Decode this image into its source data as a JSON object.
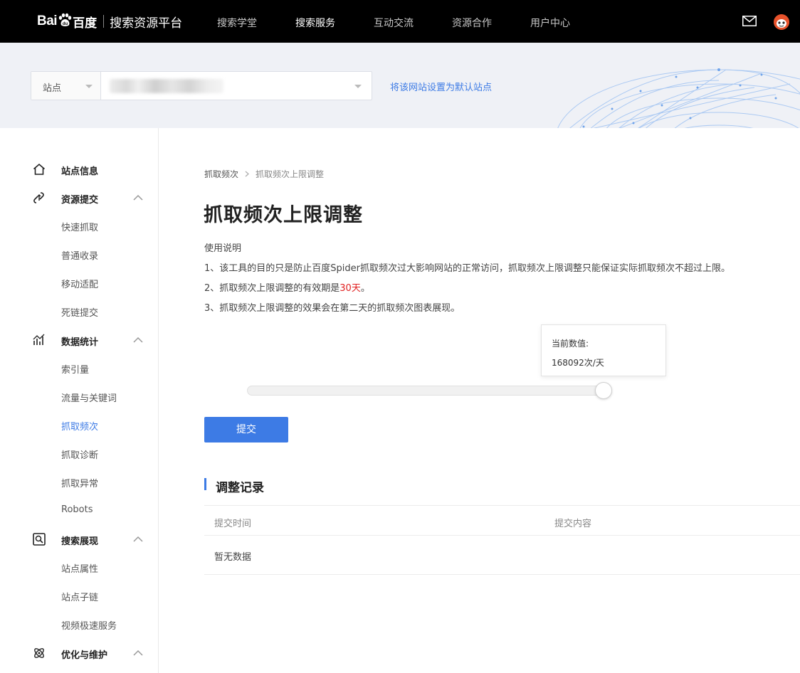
{
  "header": {
    "logo_bai": "Bai",
    "logo_du": "百度",
    "platform_title": "搜索资源平台",
    "nav": [
      {
        "label": "搜索学堂",
        "active": false
      },
      {
        "label": "搜索服务",
        "active": true
      },
      {
        "label": "互动交流",
        "active": false
      },
      {
        "label": "资源合作",
        "active": false
      },
      {
        "label": "用户中心",
        "active": false
      }
    ],
    "icons": [
      "mail-icon",
      "avatar"
    ]
  },
  "site_bar": {
    "select_label": "站点",
    "site_value_blurred": true,
    "set_default_link": "将该网站设置为默认站点"
  },
  "sidebar": {
    "groups": [
      {
        "label": "站点信息",
        "icon": "home-icon",
        "expandable": false,
        "items": []
      },
      {
        "label": "资源提交",
        "icon": "link-submit-icon",
        "expandable": true,
        "items": [
          "快速抓取",
          "普通收录",
          "移动适配",
          "死链提交"
        ]
      },
      {
        "label": "数据统计",
        "icon": "stats-icon",
        "expandable": true,
        "items": [
          "索引量",
          "流量与关键词",
          "抓取频次",
          "抓取诊断",
          "抓取异常",
          "Robots"
        ]
      },
      {
        "label": "搜索展现",
        "icon": "search-display-icon",
        "expandable": true,
        "items": [
          "站点属性",
          "站点子链",
          "视频极速服务"
        ]
      },
      {
        "label": "优化与维护",
        "icon": "atom-icon",
        "expandable": true,
        "items": []
      }
    ],
    "active_item": "抓取频次"
  },
  "main": {
    "breadcrumb": [
      "抓取频次",
      "抓取频次上限调整"
    ],
    "title": "抓取频次上限调整",
    "instructions_heading": "使用说明",
    "instructions": [
      "1、该工具的目的只是防止百度Spider抓取频次过大影响网站的正常访问，抓取频次上限调整只能保证实际抓取频次不超过上限。",
      "2、抓取频次上限调整的有效期是",
      "3、抓取频次上限调整的效果会在第二天的抓取频次图表展现。"
    ],
    "validity_period": "30天",
    "slider": {
      "tooltip_label": "当前数值:",
      "tooltip_value": "168092次/天",
      "fraction": 1.0
    },
    "submit_label": "提交",
    "records": {
      "title": "调整记录",
      "columns": [
        "提交时间",
        "提交内容"
      ],
      "empty_text": "暂无数据",
      "rows": []
    }
  },
  "colors": {
    "accent": "#3d7be5",
    "topbar": "#000000",
    "banner": "#eff1f6",
    "highlight_red": "#e02020"
  }
}
